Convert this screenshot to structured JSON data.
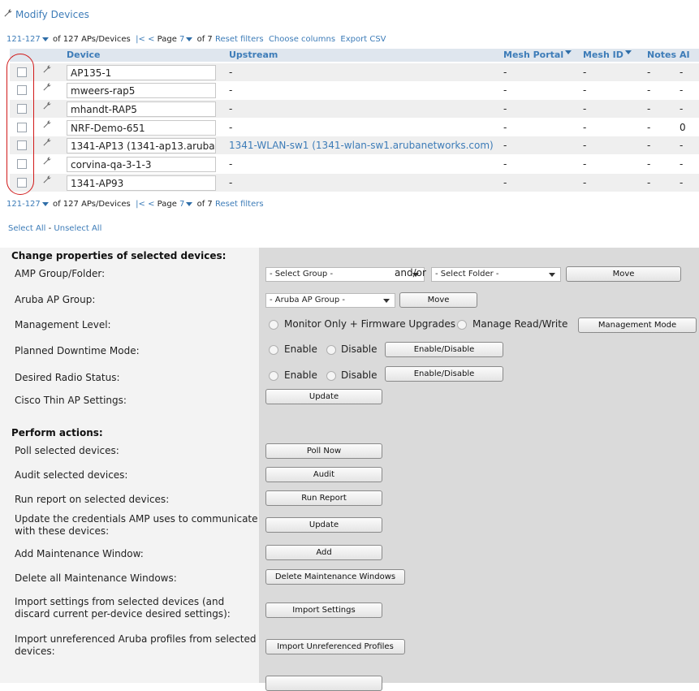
{
  "header": {
    "modify_link": "Modify Devices"
  },
  "pager_top": {
    "range": "121-127",
    "of_text": "of 127 APs/Devices",
    "first": "|<",
    "prev": "<",
    "page_label": "Page",
    "page_num": "7",
    "of_pages": "of 7",
    "reset": "Reset filters",
    "choose_cols": "Choose columns",
    "export": "Export CSV"
  },
  "pager_bottom": {
    "range": "121-127",
    "of_text": "of 127 APs/Devices",
    "first": "|<",
    "prev": "<",
    "page_label": "Page",
    "page_num": "7",
    "of_pages": "of 7",
    "reset": "Reset filters"
  },
  "table": {
    "columns": [
      "Device",
      "Upstream",
      "Mesh Portal",
      "Mesh ID",
      "Notes",
      "AI"
    ],
    "rows": [
      {
        "device": "AP135-1",
        "upstream": "-",
        "mesh_portal": "-",
        "mesh_id": "-",
        "notes": "-",
        "ai": "-"
      },
      {
        "device": "mweers-rap5",
        "upstream": "-",
        "mesh_portal": "-",
        "mesh_id": "-",
        "notes": "-",
        "ai": "-"
      },
      {
        "device": "mhandt-RAP5",
        "upstream": "-",
        "mesh_portal": "-",
        "mesh_id": "-",
        "notes": "-",
        "ai": "-"
      },
      {
        "device": "NRF-Demo-651",
        "upstream": "-",
        "mesh_portal": "-",
        "mesh_id": "-",
        "notes": "-",
        "ai": "0"
      },
      {
        "device": "1341-AP13 (1341-ap13.arubar",
        "upstream": "1341-WLAN-sw1 (1341-wlan-sw1.arubanetworks.com)",
        "mesh_portal": "-",
        "mesh_id": "-",
        "notes": "-",
        "ai": "-"
      },
      {
        "device": "corvina-qa-3-1-3",
        "upstream": "-",
        "mesh_portal": "-",
        "mesh_id": "-",
        "notes": "-",
        "ai": "-"
      },
      {
        "device": "1341-AP93",
        "upstream": "-",
        "mesh_portal": "-",
        "mesh_id": "-",
        "notes": "-",
        "ai": "-"
      }
    ]
  },
  "selection": {
    "select_all": "Select All",
    "sep": "-",
    "unselect_all": "Unselect All"
  },
  "change_section": {
    "title": "Change properties of selected devices:",
    "amp_group_label": "AMP Group/Folder:",
    "select_group": "- Select Group -",
    "andor": "and/or",
    "select_folder": "- Select Folder -",
    "move": "Move",
    "aruba_group_label": "Aruba AP Group:",
    "aruba_group_select": "- Aruba AP Group -",
    "move2": "Move",
    "mgmt_label": "Management Level:",
    "mgmt_opt1": "Monitor Only + Firmware Upgrades",
    "mgmt_opt2": "Manage Read/Write",
    "mgmt_btn": "Management Mode",
    "downtime_label": "Planned Downtime Mode:",
    "enable": "Enable",
    "disable": "Disable",
    "enable_disable": "Enable/Disable",
    "radio_label": "Desired Radio Status:",
    "cisco_label": "Cisco Thin AP Settings:",
    "update": "Update"
  },
  "actions_section": {
    "title": "Perform actions:",
    "poll_label": "Poll selected devices:",
    "poll_btn": "Poll Now",
    "audit_label": "Audit selected devices:",
    "audit_btn": "Audit",
    "report_label": "Run report on selected devices:",
    "report_btn": "Run Report",
    "creds_label": "Update the credentials AMP uses to communicate with these devices:",
    "creds_btn": "Update",
    "maint_label": "Add Maintenance Window:",
    "maint_btn": "Add",
    "del_maint_label": "Delete all Maintenance Windows:",
    "del_maint_btn": "Delete Maintenance Windows",
    "import_label": "Import settings from selected devices (and discard current per-device desired settings):",
    "import_btn": "Import Settings",
    "unref_label": "Import unreferenced Aruba profiles from selected devices:",
    "unref_btn": "Import Unreferenced Profiles"
  },
  "colors": {
    "link": "#3d7cb8",
    "header_bg": "#dfe6ee",
    "panel_right": "#dadada",
    "annotation": "#d11a1a"
  }
}
